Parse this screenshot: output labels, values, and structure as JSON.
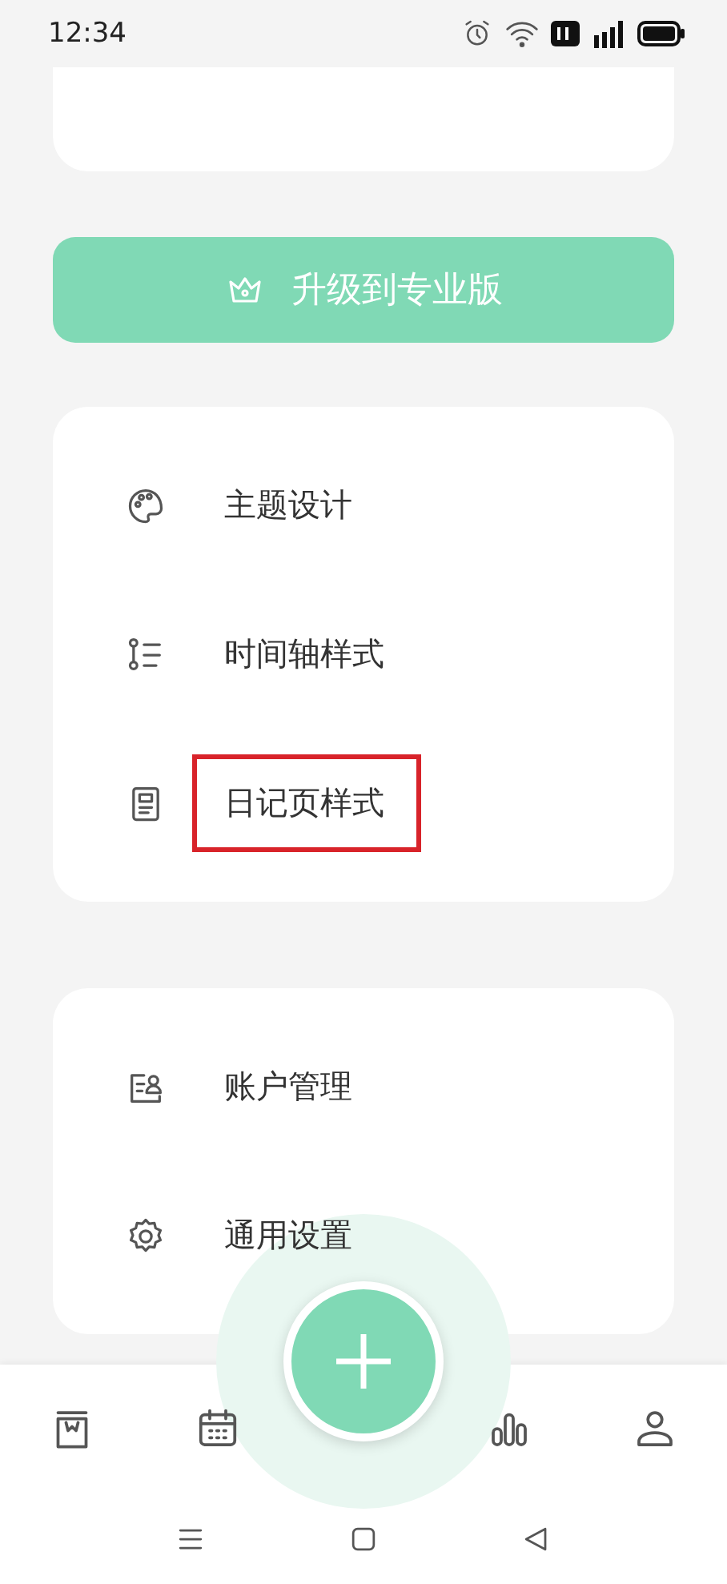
{
  "status_bar": {
    "time": "12:34"
  },
  "upgrade_button": {
    "label": "升级到专业版"
  },
  "style_menu": [
    {
      "kind": "palette",
      "label": "主题设计",
      "highlighted": false
    },
    {
      "kind": "timeline",
      "label": "时间轴样式",
      "highlighted": false
    },
    {
      "kind": "page",
      "label": "日记页样式",
      "highlighted": true
    }
  ],
  "settings_menu": [
    {
      "kind": "account",
      "label": "账户管理",
      "highlighted": false
    },
    {
      "kind": "gear",
      "label": "通用设置",
      "highlighted": false
    }
  ],
  "bottom_nav": [
    {
      "kind": "diary"
    },
    {
      "kind": "calendar"
    },
    {
      "kind": "add"
    },
    {
      "kind": "stats"
    },
    {
      "kind": "profile"
    }
  ],
  "system_nav": [
    {
      "kind": "menu"
    },
    {
      "kind": "home"
    },
    {
      "kind": "back"
    }
  ]
}
